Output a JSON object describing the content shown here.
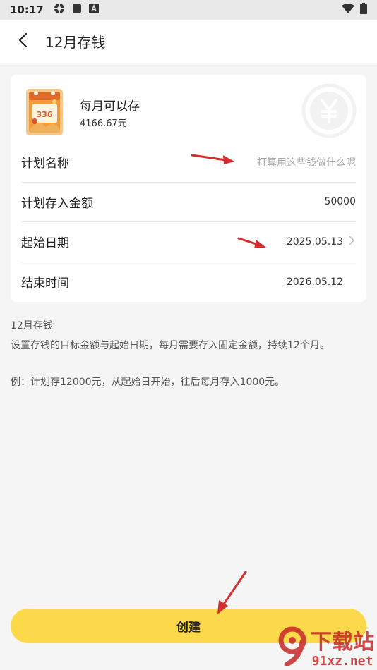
{
  "status_bar": {
    "time": "10:17",
    "icons": [
      "settings-icon",
      "square-icon",
      "text-a-icon"
    ],
    "right_icons": [
      "wifi-icon",
      "battery-icon"
    ]
  },
  "header": {
    "title": "12月存钱",
    "back_icon": "chevron-left-icon"
  },
  "summary": {
    "label": "每月可以存",
    "amount": "4166.67元",
    "calendar_number": "336"
  },
  "form": {
    "name_label": "计划名称",
    "name_placeholder": "打算用这些钱做什么呢",
    "amount_label": "计划存入金额",
    "amount_value": "50000",
    "start_label": "起始日期",
    "start_value": "2025.05.13",
    "end_label": "结束时间",
    "end_value": "2026.05.12"
  },
  "description": {
    "title": "12月存钱",
    "text": "设置存钱的目标金额与起始日期，每月需要存入固定金额，持续12个月。",
    "example": "例：计划存12000元，从起始日开始，往后每月存入1000元。"
  },
  "create_button": "创建",
  "watermark": {
    "cn": "下载站",
    "url": "91xz.net"
  },
  "colors": {
    "accent_yellow": "#fcd94a",
    "annotation_red": "#d32f2f"
  }
}
